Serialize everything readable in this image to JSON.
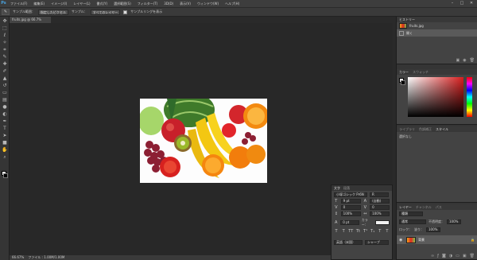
{
  "app": {
    "logo": "Ps"
  },
  "menu": [
    "ファイル(F)",
    "編集(E)",
    "イメージ(I)",
    "レイヤー(L)",
    "書式(Y)",
    "選択範囲(S)",
    "フィルター(T)",
    "3D(D)",
    "表示(V)",
    "ウィンドウ(W)",
    "ヘルプ(H)"
  ],
  "window_controls": {
    "minimize": "–",
    "maximize": "□",
    "close": "✕"
  },
  "options_bar": {
    "tool_icon": "eyedropper-icon",
    "sample_size_label": "サンプル範囲：",
    "sample_size_value": "指定したピクセル",
    "sample_label": "サンプル：",
    "sample_value": "すべてのレイヤー",
    "show_ring_label": "サンプルリングを表示"
  },
  "document": {
    "tab_label": "fruits.jpg @ 66.7%"
  },
  "status": {
    "zoom": "66.67%",
    "doc_info": "ファイル : 1.00M/1.00M"
  },
  "character_panel": {
    "tabs": [
      "文字",
      "段落"
    ],
    "font_family": "小塚ゴシック Pr6N",
    "font_style": "R",
    "size": "9 pt",
    "leading": "(自動)",
    "kerning": "0",
    "tracking": "0",
    "scale_v": "100%",
    "scale_h": "100%",
    "baseline": "0 pt",
    "color_label": "カラー：",
    "style_buttons": [
      "T",
      "T",
      "TT",
      "Tt",
      "T¹",
      "T₁",
      "T",
      "T"
    ],
    "language": "英語（米国）",
    "aa": "シャープ"
  },
  "history_panel": {
    "tabs": [
      "ヒストリー"
    ],
    "items": [
      {
        "label": "fruits.jpg",
        "kind": "snapshot"
      },
      {
        "label": "開く",
        "kind": "step"
      }
    ]
  },
  "color_panel": {
    "tabs": [
      "カラー",
      "スウォッチ"
    ]
  },
  "adjust_panel": {
    "tabs": [
      "ライブラリ",
      "色調補正",
      "スタイル"
    ],
    "text": "選択なし"
  },
  "layers_panel": {
    "tabs": [
      "レイヤー",
      "チャンネル",
      "パス"
    ],
    "filter": "種類",
    "blend_mode": "通常",
    "opacity_label": "不透明度：",
    "opacity": "100%",
    "lock_label": "ロック：",
    "fill_label": "塗り：",
    "fill": "100%",
    "layer_name": "背景"
  },
  "colors": {
    "accent": "#4aa3df",
    "bg": "#262626",
    "panel": "#434343"
  }
}
